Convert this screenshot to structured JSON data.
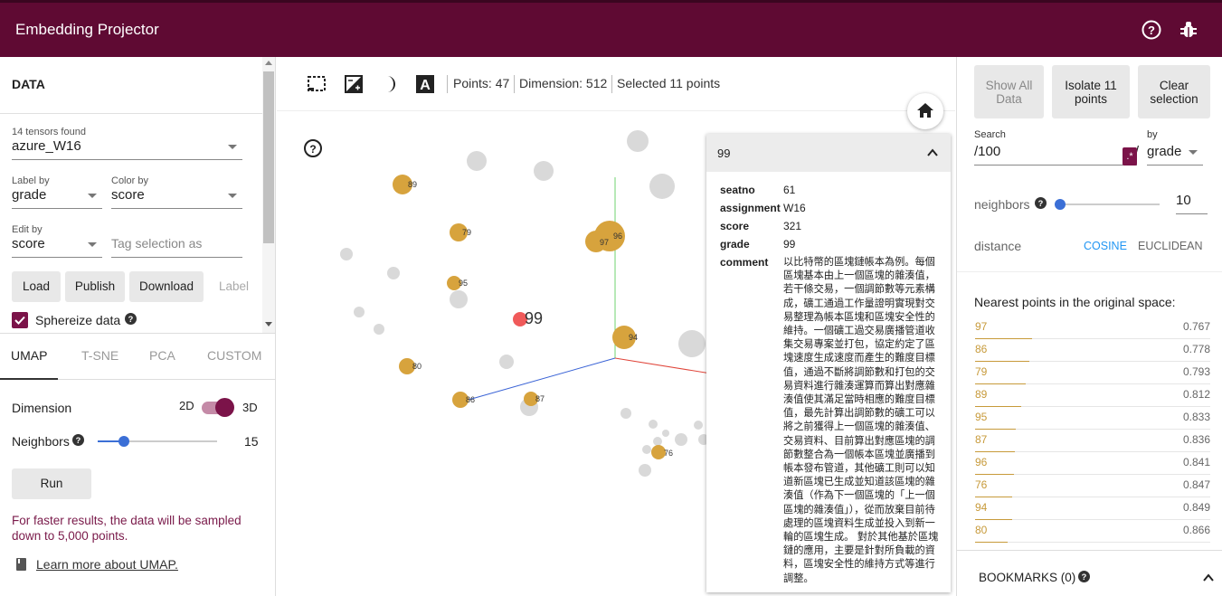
{
  "app": {
    "title": "Embedding Projector"
  },
  "data_panel": {
    "heading": "DATA",
    "tensors_found": "14 tensors found",
    "tensor_value": "azure_W16",
    "label_by": {
      "label": "Label by",
      "value": "grade"
    },
    "color_by": {
      "label": "Color by",
      "value": "score"
    },
    "edit_by": {
      "label": "Edit by",
      "value": "score"
    },
    "tag_placeholder": "Tag selection as",
    "buttons": {
      "load": "Load",
      "publish": "Publish",
      "download": "Download",
      "label": "Label"
    },
    "sphereize": "Sphereize data"
  },
  "projection_tabs": [
    "UMAP",
    "T-SNE",
    "PCA",
    "CUSTOM"
  ],
  "umap": {
    "dimension_label": "Dimension",
    "dim_2d": "2D",
    "dim_3d": "3D",
    "neighbors_label": "Neighbors",
    "neighbors_value": "15",
    "neighbors_fraction": 0.22,
    "run": "Run",
    "note": "For faster results, the data will be sampled down to 5,000 points.",
    "learn_more": "Learn more about UMAP."
  },
  "toolbar": {
    "points": "Points: 47",
    "dimension": "Dimension: 512",
    "selected": "Selected 11 points"
  },
  "scatter": {
    "selected_label": "99",
    "labels": [
      "89",
      "79",
      "97",
      "96",
      "95",
      "94",
      "80",
      "86",
      "87",
      "76"
    ]
  },
  "inspector": {
    "title": "99",
    "fields": [
      {
        "key": "seatno",
        "value": "61"
      },
      {
        "key": "assignment",
        "value": "W16"
      },
      {
        "key": "score",
        "value": "321"
      },
      {
        "key": "grade",
        "value": "99"
      }
    ],
    "comment_key": "comment",
    "comment_value": "以比特幣的區塊鏈帳本為例。每個區塊基本由上一個區塊的雜湊值，若干條交易，一個調節數等元素構成，礦工通過工作量證明實現對交易整理為帳本區塊和區塊安全性的維持。一個礦工過交易廣播管道收集交易專案並打包，協定約定了區塊速度生成速度而產生的難度目標值，通過不斷將調節數和打包的交易資料進行雜湊運算而算出對應雜湊值使其滿足當時相應的難度目標值，最先計算出調節數的礦工可以將之前獲得上一個區塊的雜湊值、交易資料、目前算出對應區塊的調節數整合為一個帳本區塊並廣播到帳本發布管道，其他礦工則可以知道新區塊已生成並知道該區塊的雜湊值（作為下一個區塊的「上一個區塊的雜湊值」），從而放棄目前待處理的區塊資料生成並投入到新一輪的區塊生成。 對於其他基於區塊鏈的應用，主要是針對所負載的資料，區塊安全性的維持方式等進行調整。"
  },
  "right_panel": {
    "show_all": "Show All Data",
    "isolate": "Isolate 11 points",
    "clear": "Clear selection",
    "search_label": "Search",
    "search_value": "/100",
    "regex_icon": ".*",
    "by_label": "by",
    "by_value": "grade",
    "neighbors_label": "neighbors",
    "neighbors_value": "10",
    "neighbors_fraction": 0.0,
    "distance_label": "distance",
    "cosine": "COSINE",
    "euclidean": "EUCLIDEAN",
    "nearest_title": "Nearest points in the original space:",
    "nearest": [
      {
        "name": "97",
        "value": "0.767"
      },
      {
        "name": "86",
        "value": "0.778"
      },
      {
        "name": "79",
        "value": "0.793"
      },
      {
        "name": "89",
        "value": "0.812"
      },
      {
        "name": "95",
        "value": "0.833"
      },
      {
        "name": "87",
        "value": "0.836"
      },
      {
        "name": "96",
        "value": "0.841"
      },
      {
        "name": "76",
        "value": "0.847"
      },
      {
        "name": "94",
        "value": "0.849"
      },
      {
        "name": "80",
        "value": "0.866"
      }
    ],
    "bookmarks": "BOOKMARKS (0)"
  },
  "colors": {
    "brand": "#5f0a33",
    "accent": "#2196f3",
    "point_selected": "#d7a33d",
    "point_main": "#f05a5a",
    "point_other": "#d9d9d9"
  }
}
